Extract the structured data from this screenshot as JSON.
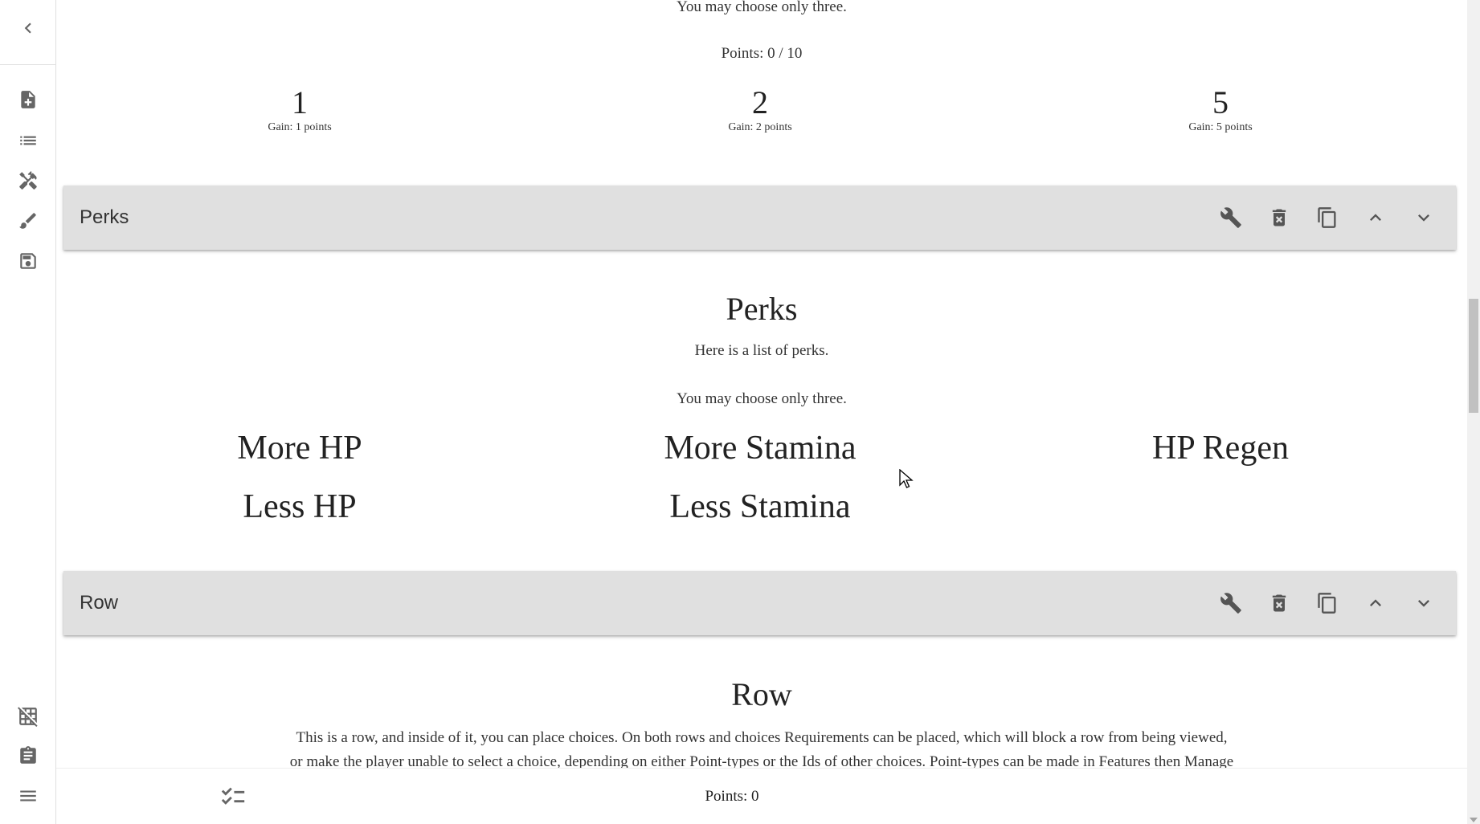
{
  "sidebar": {
    "icons": [
      "back-chevron-icon",
      "add-document-icon",
      "list-icon",
      "tools-icon",
      "brush-icon",
      "save-icon",
      "grid-off-icon",
      "clipboard-icon",
      "menu-icon"
    ]
  },
  "top_section": {
    "restriction": "You may choose only three.",
    "points": "Points: 0 / 10",
    "choices": [
      {
        "value": "1",
        "gain": "Gain: 1 points"
      },
      {
        "value": "2",
        "gain": "Gain: 2 points"
      },
      {
        "value": "5",
        "gain": "Gain: 5 points"
      }
    ]
  },
  "perks_bar": {
    "title": "Perks",
    "actions": [
      "wrench-icon",
      "delete-icon",
      "copy-icon",
      "chevron-up-icon",
      "chevron-down-icon"
    ]
  },
  "perks_section": {
    "title": "Perks",
    "description": "Here is a list of perks.",
    "restriction": "You may choose only three.",
    "perks": [
      "More HP",
      "More Stamina",
      "HP Regen",
      "Less HP",
      "Less Stamina"
    ]
  },
  "row_bar": {
    "title": "Row"
  },
  "row_section": {
    "title": "Row",
    "line1": "This is a row, and inside of it, you can place choices. On both rows and choices Requirements can be placed, which will block a row from being viewed,",
    "line2": "or make the player unable to select a choice, depending on either Point-types or the Ids of other choices. Point-types can be made in Features then Manage"
  },
  "footer": {
    "points": "Points: 0"
  },
  "colors": {
    "bar_bg": "#e0e0e0",
    "icon": "#666666"
  }
}
